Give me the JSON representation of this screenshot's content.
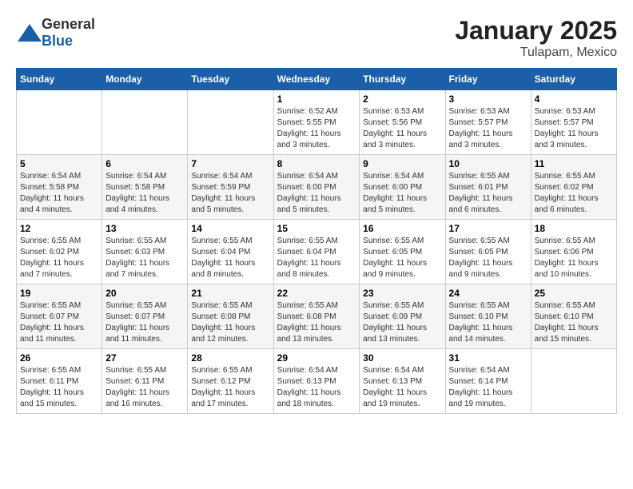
{
  "header": {
    "logo": {
      "general": "General",
      "blue": "Blue"
    },
    "title": "January 2025",
    "location": "Tulapam, Mexico"
  },
  "calendar": {
    "days_of_week": [
      "Sunday",
      "Monday",
      "Tuesday",
      "Wednesday",
      "Thursday",
      "Friday",
      "Saturday"
    ],
    "weeks": [
      [
        {
          "day": "",
          "info": ""
        },
        {
          "day": "",
          "info": ""
        },
        {
          "day": "",
          "info": ""
        },
        {
          "day": "1",
          "info": "Sunrise: 6:52 AM\nSunset: 5:55 PM\nDaylight: 11 hours and 3 minutes."
        },
        {
          "day": "2",
          "info": "Sunrise: 6:53 AM\nSunset: 5:56 PM\nDaylight: 11 hours and 3 minutes."
        },
        {
          "day": "3",
          "info": "Sunrise: 6:53 AM\nSunset: 5:57 PM\nDaylight: 11 hours and 3 minutes."
        },
        {
          "day": "4",
          "info": "Sunrise: 6:53 AM\nSunset: 5:57 PM\nDaylight: 11 hours and 3 minutes."
        }
      ],
      [
        {
          "day": "5",
          "info": "Sunrise: 6:54 AM\nSunset: 5:58 PM\nDaylight: 11 hours and 4 minutes."
        },
        {
          "day": "6",
          "info": "Sunrise: 6:54 AM\nSunset: 5:58 PM\nDaylight: 11 hours and 4 minutes."
        },
        {
          "day": "7",
          "info": "Sunrise: 6:54 AM\nSunset: 5:59 PM\nDaylight: 11 hours and 5 minutes."
        },
        {
          "day": "8",
          "info": "Sunrise: 6:54 AM\nSunset: 6:00 PM\nDaylight: 11 hours and 5 minutes."
        },
        {
          "day": "9",
          "info": "Sunrise: 6:54 AM\nSunset: 6:00 PM\nDaylight: 11 hours and 5 minutes."
        },
        {
          "day": "10",
          "info": "Sunrise: 6:55 AM\nSunset: 6:01 PM\nDaylight: 11 hours and 6 minutes."
        },
        {
          "day": "11",
          "info": "Sunrise: 6:55 AM\nSunset: 6:02 PM\nDaylight: 11 hours and 6 minutes."
        }
      ],
      [
        {
          "day": "12",
          "info": "Sunrise: 6:55 AM\nSunset: 6:02 PM\nDaylight: 11 hours and 7 minutes."
        },
        {
          "day": "13",
          "info": "Sunrise: 6:55 AM\nSunset: 6:03 PM\nDaylight: 11 hours and 7 minutes."
        },
        {
          "day": "14",
          "info": "Sunrise: 6:55 AM\nSunset: 6:04 PM\nDaylight: 11 hours and 8 minutes."
        },
        {
          "day": "15",
          "info": "Sunrise: 6:55 AM\nSunset: 6:04 PM\nDaylight: 11 hours and 8 minutes."
        },
        {
          "day": "16",
          "info": "Sunrise: 6:55 AM\nSunset: 6:05 PM\nDaylight: 11 hours and 9 minutes."
        },
        {
          "day": "17",
          "info": "Sunrise: 6:55 AM\nSunset: 6:05 PM\nDaylight: 11 hours and 9 minutes."
        },
        {
          "day": "18",
          "info": "Sunrise: 6:55 AM\nSunset: 6:06 PM\nDaylight: 11 hours and 10 minutes."
        }
      ],
      [
        {
          "day": "19",
          "info": "Sunrise: 6:55 AM\nSunset: 6:07 PM\nDaylight: 11 hours and 11 minutes."
        },
        {
          "day": "20",
          "info": "Sunrise: 6:55 AM\nSunset: 6:07 PM\nDaylight: 11 hours and 11 minutes."
        },
        {
          "day": "21",
          "info": "Sunrise: 6:55 AM\nSunset: 6:08 PM\nDaylight: 11 hours and 12 minutes."
        },
        {
          "day": "22",
          "info": "Sunrise: 6:55 AM\nSunset: 6:08 PM\nDaylight: 11 hours and 13 minutes."
        },
        {
          "day": "23",
          "info": "Sunrise: 6:55 AM\nSunset: 6:09 PM\nDaylight: 11 hours and 13 minutes."
        },
        {
          "day": "24",
          "info": "Sunrise: 6:55 AM\nSunset: 6:10 PM\nDaylight: 11 hours and 14 minutes."
        },
        {
          "day": "25",
          "info": "Sunrise: 6:55 AM\nSunset: 6:10 PM\nDaylight: 11 hours and 15 minutes."
        }
      ],
      [
        {
          "day": "26",
          "info": "Sunrise: 6:55 AM\nSunset: 6:11 PM\nDaylight: 11 hours and 15 minutes."
        },
        {
          "day": "27",
          "info": "Sunrise: 6:55 AM\nSunset: 6:11 PM\nDaylight: 11 hours and 16 minutes."
        },
        {
          "day": "28",
          "info": "Sunrise: 6:55 AM\nSunset: 6:12 PM\nDaylight: 11 hours and 17 minutes."
        },
        {
          "day": "29",
          "info": "Sunrise: 6:54 AM\nSunset: 6:13 PM\nDaylight: 11 hours and 18 minutes."
        },
        {
          "day": "30",
          "info": "Sunrise: 6:54 AM\nSunset: 6:13 PM\nDaylight: 11 hours and 19 minutes."
        },
        {
          "day": "31",
          "info": "Sunrise: 6:54 AM\nSunset: 6:14 PM\nDaylight: 11 hours and 19 minutes."
        },
        {
          "day": "",
          "info": ""
        }
      ]
    ]
  }
}
